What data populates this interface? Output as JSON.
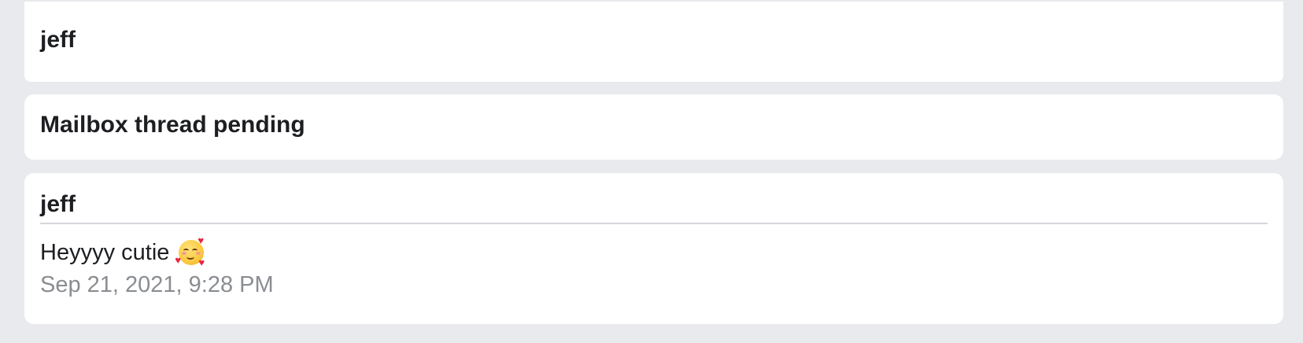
{
  "header": {
    "name": "jeff"
  },
  "status": {
    "label": "Mailbox thread pending"
  },
  "message": {
    "sender": "jeff",
    "text": "Heyyyy cutie",
    "emoji_icon": "smiling-face-with-hearts-icon",
    "timestamp": "Sep 21, 2021, 9:28 PM"
  },
  "colors": {
    "background": "#e9eaed",
    "card": "#ffffff",
    "text": "#1c1e21",
    "muted_text": "#8a8d91",
    "divider": "#d6d8dc"
  }
}
